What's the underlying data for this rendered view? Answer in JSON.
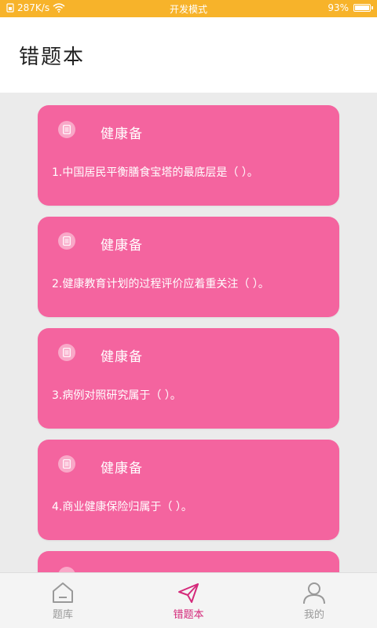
{
  "status_bar": {
    "speed": "287K/s",
    "mode": "开发模式",
    "battery": "93%"
  },
  "header": {
    "title": "错题本"
  },
  "cards": [
    {
      "category": "健康备",
      "question": "1.中国居民平衡膳食宝塔的最底层是（ ）。"
    },
    {
      "category": "健康备",
      "question": "2.健康教育计划的过程评价应着重关注（ ）。"
    },
    {
      "category": "健康备",
      "question": "3.病例对照研究属于（ ）。"
    },
    {
      "category": "健康备",
      "question": "4.商业健康保险归属于（ ）。"
    }
  ],
  "tabbar": {
    "items": [
      {
        "label": "题库",
        "icon": "home-icon"
      },
      {
        "label": "错题本",
        "icon": "paper-plane-icon"
      },
      {
        "label": "我的",
        "icon": "user-icon"
      }
    ]
  },
  "colors": {
    "status_bar": "#f7b32a",
    "card": "#f4649f",
    "active_tab": "#d4297a"
  }
}
